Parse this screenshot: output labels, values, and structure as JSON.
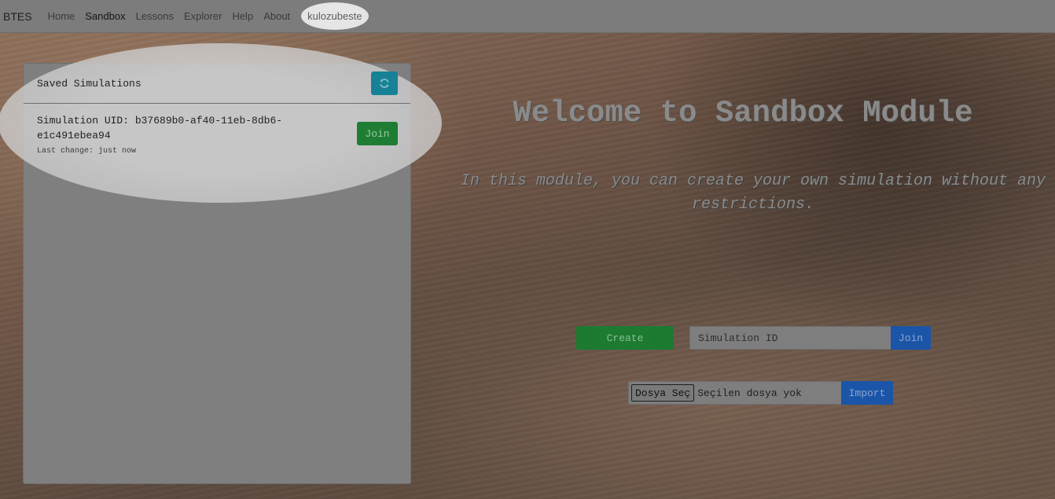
{
  "navbar": {
    "brand": "BTES",
    "links": [
      {
        "label": "Home"
      },
      {
        "label": "Sandbox"
      },
      {
        "label": "Lessons"
      },
      {
        "label": "Explorer"
      },
      {
        "label": "Help"
      },
      {
        "label": "About"
      }
    ],
    "active": "Sandbox",
    "user": "kulozubeste"
  },
  "saved_panel": {
    "title": "Saved Simulations",
    "refresh_icon": "refresh-icon",
    "items": [
      {
        "uid_label": "Simulation UID: b37689b0-af40-11eb-8db6-e1c491ebea94",
        "last_change": "Last change: just now",
        "join_label": "Join"
      }
    ]
  },
  "hero": {
    "title": "Welcome to Sandbox Module",
    "subtitle": "In this module, you can create your own simulation without any restrictions."
  },
  "actions": {
    "create_label": "Create",
    "sim_id_placeholder": "Simulation ID",
    "join_label": "Join",
    "file_choose_label": "Dosya Seç",
    "file_status": "Seçilen dosya yok",
    "import_label": "Import"
  },
  "colors": {
    "refresh": "#178196",
    "green": "#1f7d33",
    "blue": "#1a55a8"
  }
}
